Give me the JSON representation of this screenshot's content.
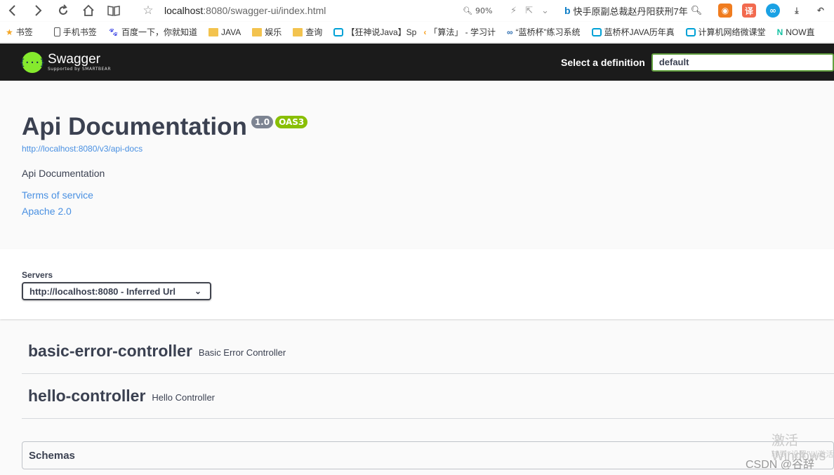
{
  "browser": {
    "url_host": "localhost",
    "url_path": ":8080/swagger-ui/index.html",
    "zoom": "90%",
    "search_text": "快手原副总裁赵丹阳获刑7年"
  },
  "bookmarks": [
    {
      "label": "书签",
      "icon": "star-icon"
    },
    {
      "label": "手机书签",
      "icon": "phone-icon"
    },
    {
      "label": "百度一下，你就知道",
      "icon": "baidu-icon"
    },
    {
      "label": "JAVA",
      "icon": "folder-icon"
    },
    {
      "label": "娱乐",
      "icon": "folder-icon"
    },
    {
      "label": "查询",
      "icon": "folder-icon"
    },
    {
      "label": "【狂神说Java】Sp",
      "icon": "bilibili-icon"
    },
    {
      "label": "「算法」 - 学习计",
      "icon": "leetcode-icon"
    },
    {
      "label": "“蓝桥杯”练习系统",
      "icon": "lanqiao-icon"
    },
    {
      "label": "蓝桥杯JAVA历年真",
      "icon": "bilibili-icon"
    },
    {
      "label": "计算机网络微课堂",
      "icon": "bilibili-icon"
    },
    {
      "label": "NOW直",
      "icon": "now-icon"
    }
  ],
  "topbar": {
    "logo_text": "Swagger",
    "logo_sub": "Supported by SMARTBEAR",
    "select_label": "Select a definition",
    "select_value": "default"
  },
  "info": {
    "title": "Api Documentation",
    "version": "1.0",
    "oas": "OAS3",
    "docs_url": "http://localhost:8080/v3/api-docs",
    "description": "Api Documentation",
    "terms": "Terms of service",
    "license": "Apache 2.0"
  },
  "servers": {
    "label": "Servers",
    "selected": "http://localhost:8080 - Inferred Url"
  },
  "tags": [
    {
      "name": "basic-error-controller",
      "description": "Basic Error Controller"
    },
    {
      "name": "hello-controller",
      "description": "Hello Controller"
    }
  ],
  "schemas": {
    "title": "Schemas"
  },
  "watermark": {
    "line1": "激活 Windows",
    "line2": "转到“设置”以激活",
    "csdn": "CSDN @谷辞"
  }
}
